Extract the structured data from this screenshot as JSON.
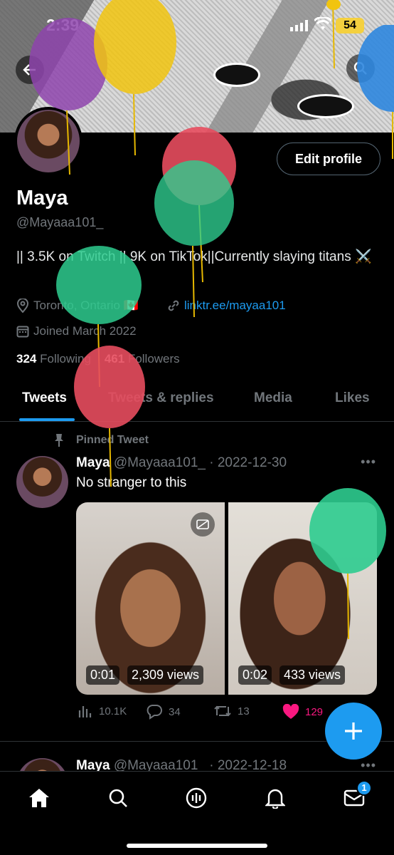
{
  "status_bar": {
    "time": "2:39",
    "battery": "54"
  },
  "profile": {
    "name": "Maya",
    "handle": "@Mayaaa101_",
    "bio": "|| 3.5K on Twitch || 9K on TikTok||Currently slaying titans ⚔️",
    "location": "Toronto, Ontario 🇨🇦",
    "link": "linktr.ee/mayaa101",
    "joined": "Joined March 2022",
    "following_count": "324",
    "following_label": "Following",
    "followers_count": "461",
    "followers_label": "Followers",
    "edit_label": "Edit profile"
  },
  "tabs": [
    {
      "label": "Tweets",
      "active": true
    },
    {
      "label": "Tweets & replies",
      "active": false
    },
    {
      "label": "Media",
      "active": false
    },
    {
      "label": "Likes",
      "active": false
    }
  ],
  "pinned_tweet": {
    "pinned_label": "Pinned Tweet",
    "author": "Maya",
    "handle": "@Mayaaa101_",
    "date": "· 2022-12-30",
    "text": "No stranger to this",
    "media": [
      {
        "duration": "0:01",
        "views": "2,309 views"
      },
      {
        "duration": "0:02",
        "views": "433 views"
      }
    ],
    "stats": {
      "views": "10.1K",
      "replies": "34",
      "retweets": "13",
      "likes": "129"
    }
  },
  "next_tweet": {
    "author": "Maya",
    "handle": "@Mayaaa101_",
    "date": "· 2022-12-18"
  },
  "nav": {
    "messages_badge": "1"
  },
  "colors": {
    "accent": "#1d9bf0",
    "like": "#f91880",
    "background": "#000000"
  }
}
